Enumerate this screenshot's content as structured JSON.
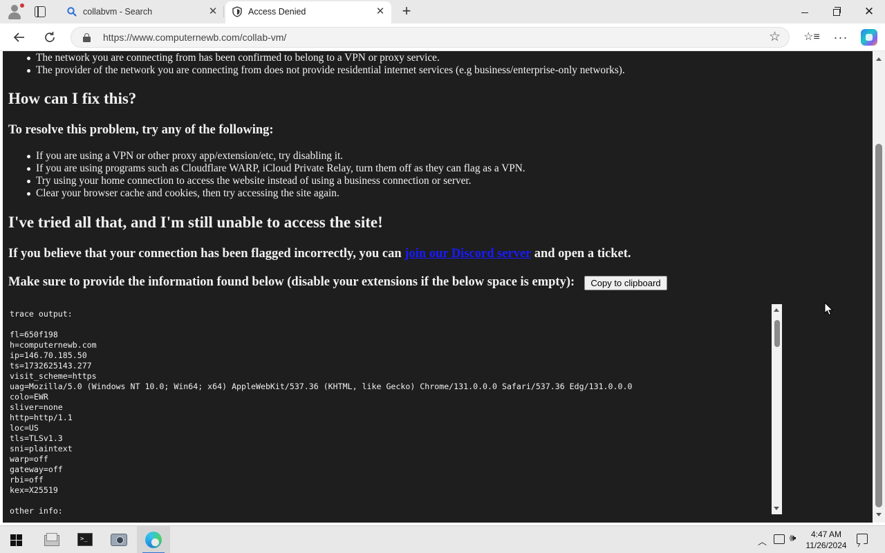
{
  "browser": {
    "tabs": [
      {
        "title": "collabvm - Search",
        "icon": "search-icon",
        "active": false
      },
      {
        "title": "Access Denied",
        "icon": "shield-icon",
        "active": true
      }
    ],
    "url": "https://www.computernewb.com/collab-vm/",
    "accent": "#1a1aff"
  },
  "page": {
    "reasons": [
      "The network you are connecting from has been confirmed to belong to a VPN or proxy service.",
      "The provider of the network you are connecting from does not provide residential internet services (e.g business/enterprise-only networks)."
    ],
    "fix_heading": "How can I fix this?",
    "fix_subheading": "To resolve this problem, try any of the following:",
    "fixes": [
      "If you are using a VPN or other proxy app/extension/etc, try disabling it.",
      "If you are using programs such as Cloudflare WARP, iCloud Private Relay, turn them off as they can flag as a VPN.",
      "Try using your home connection to access the website instead of using a business connection or server.",
      "Clear your browser cache and cookies, then try accessing the site again."
    ],
    "still_heading": "I've tried all that, and I'm still unable to access the site!",
    "contact_prefix": "If you believe that your connection has been flagged incorrectly, you can ",
    "contact_link": "join our Discord server",
    "contact_suffix": " and open a ticket.",
    "info_text": "Make sure to provide the information found below (disable your extensions if the below space is empty):",
    "copy_button": "Copy to clipboard",
    "trace_lines": [
      "trace output:",
      "",
      "fl=650f198",
      "h=computernewb.com",
      "ip=146.70.185.50",
      "ts=1732625143.277",
      "visit_scheme=https",
      "uag=Mozilla/5.0 (Windows NT 10.0; Win64; x64) AppleWebKit/537.36 (KHTML, like Gecko) Chrome/131.0.0.0 Safari/537.36 Edg/131.0.0.0",
      "colo=EWR",
      "sliver=none",
      "http=http/1.1",
      "loc=US",
      "tls=TLSv1.3",
      "sni=plaintext",
      "warp=off",
      "gateway=off",
      "rbi=off",
      "kex=X25519",
      "",
      "other info:"
    ]
  },
  "taskbar": {
    "apps": [
      "file-explorer-icon",
      "terminal-icon",
      "camera-icon",
      "edge-icon"
    ],
    "time": "4:47 AM",
    "date": "11/26/2024"
  }
}
